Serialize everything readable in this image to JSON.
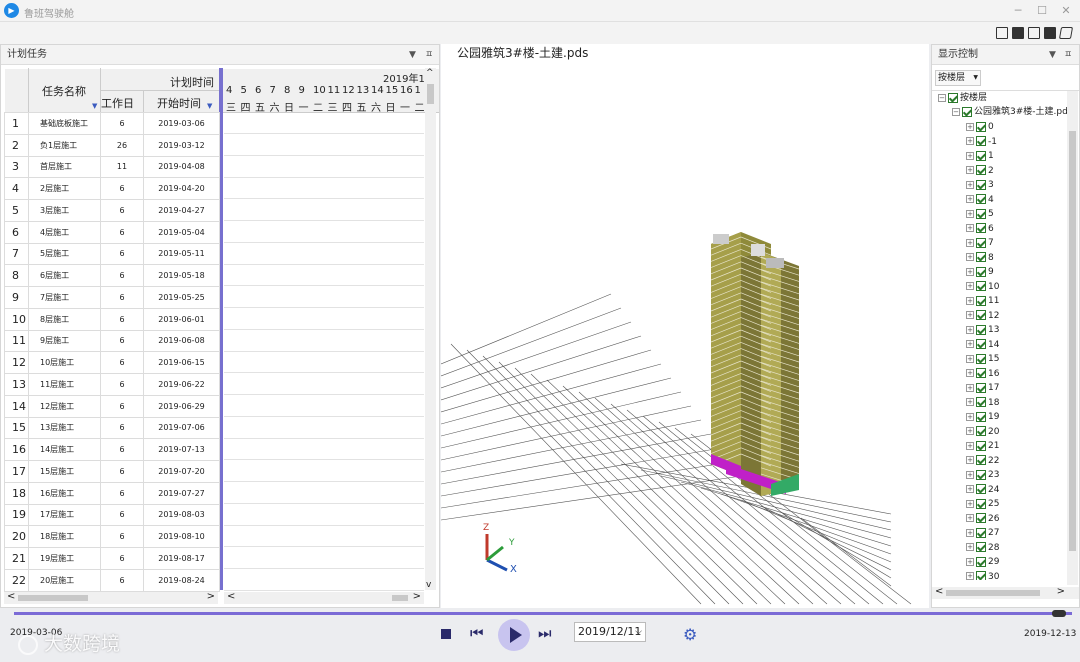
{
  "app": {
    "title": "鲁班驾驶舱"
  },
  "left_panel": {
    "title": "计划任务",
    "col_task": "任务名称",
    "col_plan": "计划时间",
    "col_workdays": "工作日",
    "col_start": "开始时间",
    "gantt_month": "2019年1",
    "gantt_days": [
      "4",
      "5",
      "6",
      "7",
      "8",
      "9",
      "10",
      "11",
      "12",
      "13",
      "14",
      "15",
      "16",
      "1"
    ],
    "gantt_weekdays": [
      "三",
      "四",
      "五",
      "六",
      "日",
      "一",
      "二",
      "三",
      "四",
      "五",
      "六",
      "日",
      "一",
      "二"
    ],
    "rows": [
      {
        "n": "1",
        "task": "基础底板施工",
        "days": "6",
        "start": "2019-03-06"
      },
      {
        "n": "2",
        "task": "负1层施工",
        "days": "26",
        "start": "2019-03-12"
      },
      {
        "n": "3",
        "task": "首层施工",
        "days": "11",
        "start": "2019-04-08"
      },
      {
        "n": "4",
        "task": "2层施工",
        "days": "6",
        "start": "2019-04-20"
      },
      {
        "n": "5",
        "task": "3层施工",
        "days": "6",
        "start": "2019-04-27"
      },
      {
        "n": "6",
        "task": "4层施工",
        "days": "6",
        "start": "2019-05-04"
      },
      {
        "n": "7",
        "task": "5层施工",
        "days": "6",
        "start": "2019-05-11"
      },
      {
        "n": "8",
        "task": "6层施工",
        "days": "6",
        "start": "2019-05-18"
      },
      {
        "n": "9",
        "task": "7层施工",
        "days": "6",
        "start": "2019-05-25"
      },
      {
        "n": "10",
        "task": "8层施工",
        "days": "6",
        "start": "2019-06-01"
      },
      {
        "n": "11",
        "task": "9层施工",
        "days": "6",
        "start": "2019-06-08"
      },
      {
        "n": "12",
        "task": "10层施工",
        "days": "6",
        "start": "2019-06-15"
      },
      {
        "n": "13",
        "task": "11层施工",
        "days": "6",
        "start": "2019-06-22"
      },
      {
        "n": "14",
        "task": "12层施工",
        "days": "6",
        "start": "2019-06-29"
      },
      {
        "n": "15",
        "task": "13层施工",
        "days": "6",
        "start": "2019-07-06"
      },
      {
        "n": "16",
        "task": "14层施工",
        "days": "6",
        "start": "2019-07-13"
      },
      {
        "n": "17",
        "task": "15层施工",
        "days": "6",
        "start": "2019-07-20"
      },
      {
        "n": "18",
        "task": "16层施工",
        "days": "6",
        "start": "2019-07-27"
      },
      {
        "n": "19",
        "task": "17层施工",
        "days": "6",
        "start": "2019-08-03"
      },
      {
        "n": "20",
        "task": "18层施工",
        "days": "6",
        "start": "2019-08-10"
      },
      {
        "n": "21",
        "task": "19层施工",
        "days": "6",
        "start": "2019-08-17"
      },
      {
        "n": "22",
        "task": "20层施工",
        "days": "6",
        "start": "2019-08-24"
      }
    ]
  },
  "view3d": {
    "title": "公园雅筑3#楼-土建.pds",
    "axis_x": "X",
    "axis_y": "Y",
    "axis_z": "Z"
  },
  "right_panel": {
    "title": "显示控制",
    "dropdown": "按楼层",
    "root": "按楼层",
    "file": "公园雅筑3#楼-土建.pds",
    "floors": [
      "0",
      "-1",
      "1",
      "2",
      "3",
      "4",
      "5",
      "6",
      "7",
      "8",
      "9",
      "10",
      "11",
      "12",
      "13",
      "14",
      "15",
      "16",
      "17",
      "18",
      "19",
      "20",
      "21",
      "22",
      "23",
      "24",
      "25",
      "26",
      "27",
      "28",
      "29",
      "30"
    ]
  },
  "playback": {
    "start_date": "2019-03-06",
    "current_date": "2019/12/11",
    "end_date": "2019-12-13",
    "watermark": "大数跨境"
  }
}
